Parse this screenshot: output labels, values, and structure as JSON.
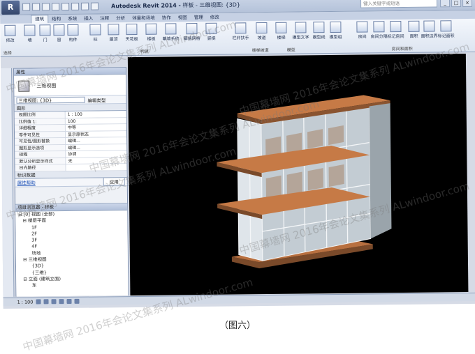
{
  "app": {
    "title_app": "Autodesk Revit 2014 -",
    "title_doc": "样板 - 三维视图: {3D}",
    "search_placeholder": "键入关键字或短语"
  },
  "ribbon": {
    "tabs": [
      "建筑",
      "结构",
      "系统",
      "插入",
      "注释",
      "分析",
      "体量和场地",
      "协作",
      "视图",
      "管理",
      "修改"
    ],
    "active_tab": "建筑",
    "buttons": [
      "修改",
      "墙",
      "门",
      "窗",
      "构件",
      "柱",
      "屋顶",
      "天花板",
      "楼板",
      "幕墙系统",
      "幕墙网格",
      "竖梃",
      "栏杆扶手",
      "坡道",
      "楼梯",
      "模型文字",
      "模型线",
      "模型组",
      "房间",
      "房间分隔",
      "标记房间",
      "面积",
      "面积边界",
      "标记面积"
    ],
    "groups": [
      "选择",
      "构建",
      "楼梯坡道",
      "模型",
      "房间和面积"
    ]
  },
  "properties": {
    "header": "属性",
    "type_name": "三维视图",
    "instance_select": "三维视图: {3D}",
    "edit_type": "编辑类型",
    "section_graphics": "图形",
    "rows": [
      {
        "k": "视图比例",
        "v": "1 : 100"
      },
      {
        "k": "比例值 1:",
        "v": "100"
      },
      {
        "k": "详细程度",
        "v": "中等"
      },
      {
        "k": "零件可见性",
        "v": "显示原状态"
      },
      {
        "k": "可见性/图形替换",
        "v": "编辑..."
      },
      {
        "k": "图形显示选项",
        "v": "编辑..."
      },
      {
        "k": "规程",
        "v": "协调"
      },
      {
        "k": "默认分析显示样式",
        "v": "无"
      },
      {
        "k": "日光路径",
        "v": ""
      }
    ],
    "section_identity": "标识数据",
    "help_link": "属性帮助",
    "apply": "应用"
  },
  "browser": {
    "header": "项目浏览器 - 样板",
    "items": [
      "⊟ [0] 视图 (全部)",
      "   ⊟ 楼层平面",
      "         1F",
      "         2F",
      "         3F",
      "         4F",
      "         场地",
      "   ⊟ 三维视图",
      "         {3D}",
      "         {三维}",
      "   ⊟ 立面 (建筑立面)",
      "         东"
    ]
  },
  "statusbar": {
    "scale": "1 : 100"
  },
  "caption": "（图六）",
  "watermarks": [
    "中国幕墙网 2016年会论文集系列 ALwindoor.com",
    "中国幕墙网 2016年会论文集系列 ALwindoor.com",
    "中国幕墙网 2016年会论文集系列 ALwindoor.com",
    "中国幕墙网 2016年会论文集系列 ALwindoor.com",
    "中国幕墙网 2016年会论文集系列 ALwindoor.com",
    "中国幕墙网 2016年会论文集系列 ALwindoor.com"
  ],
  "colors": {
    "viewport": "#000000",
    "floor_slab": "#c87848",
    "glass": "#b8c4cc",
    "frame": "#e8ecef"
  }
}
